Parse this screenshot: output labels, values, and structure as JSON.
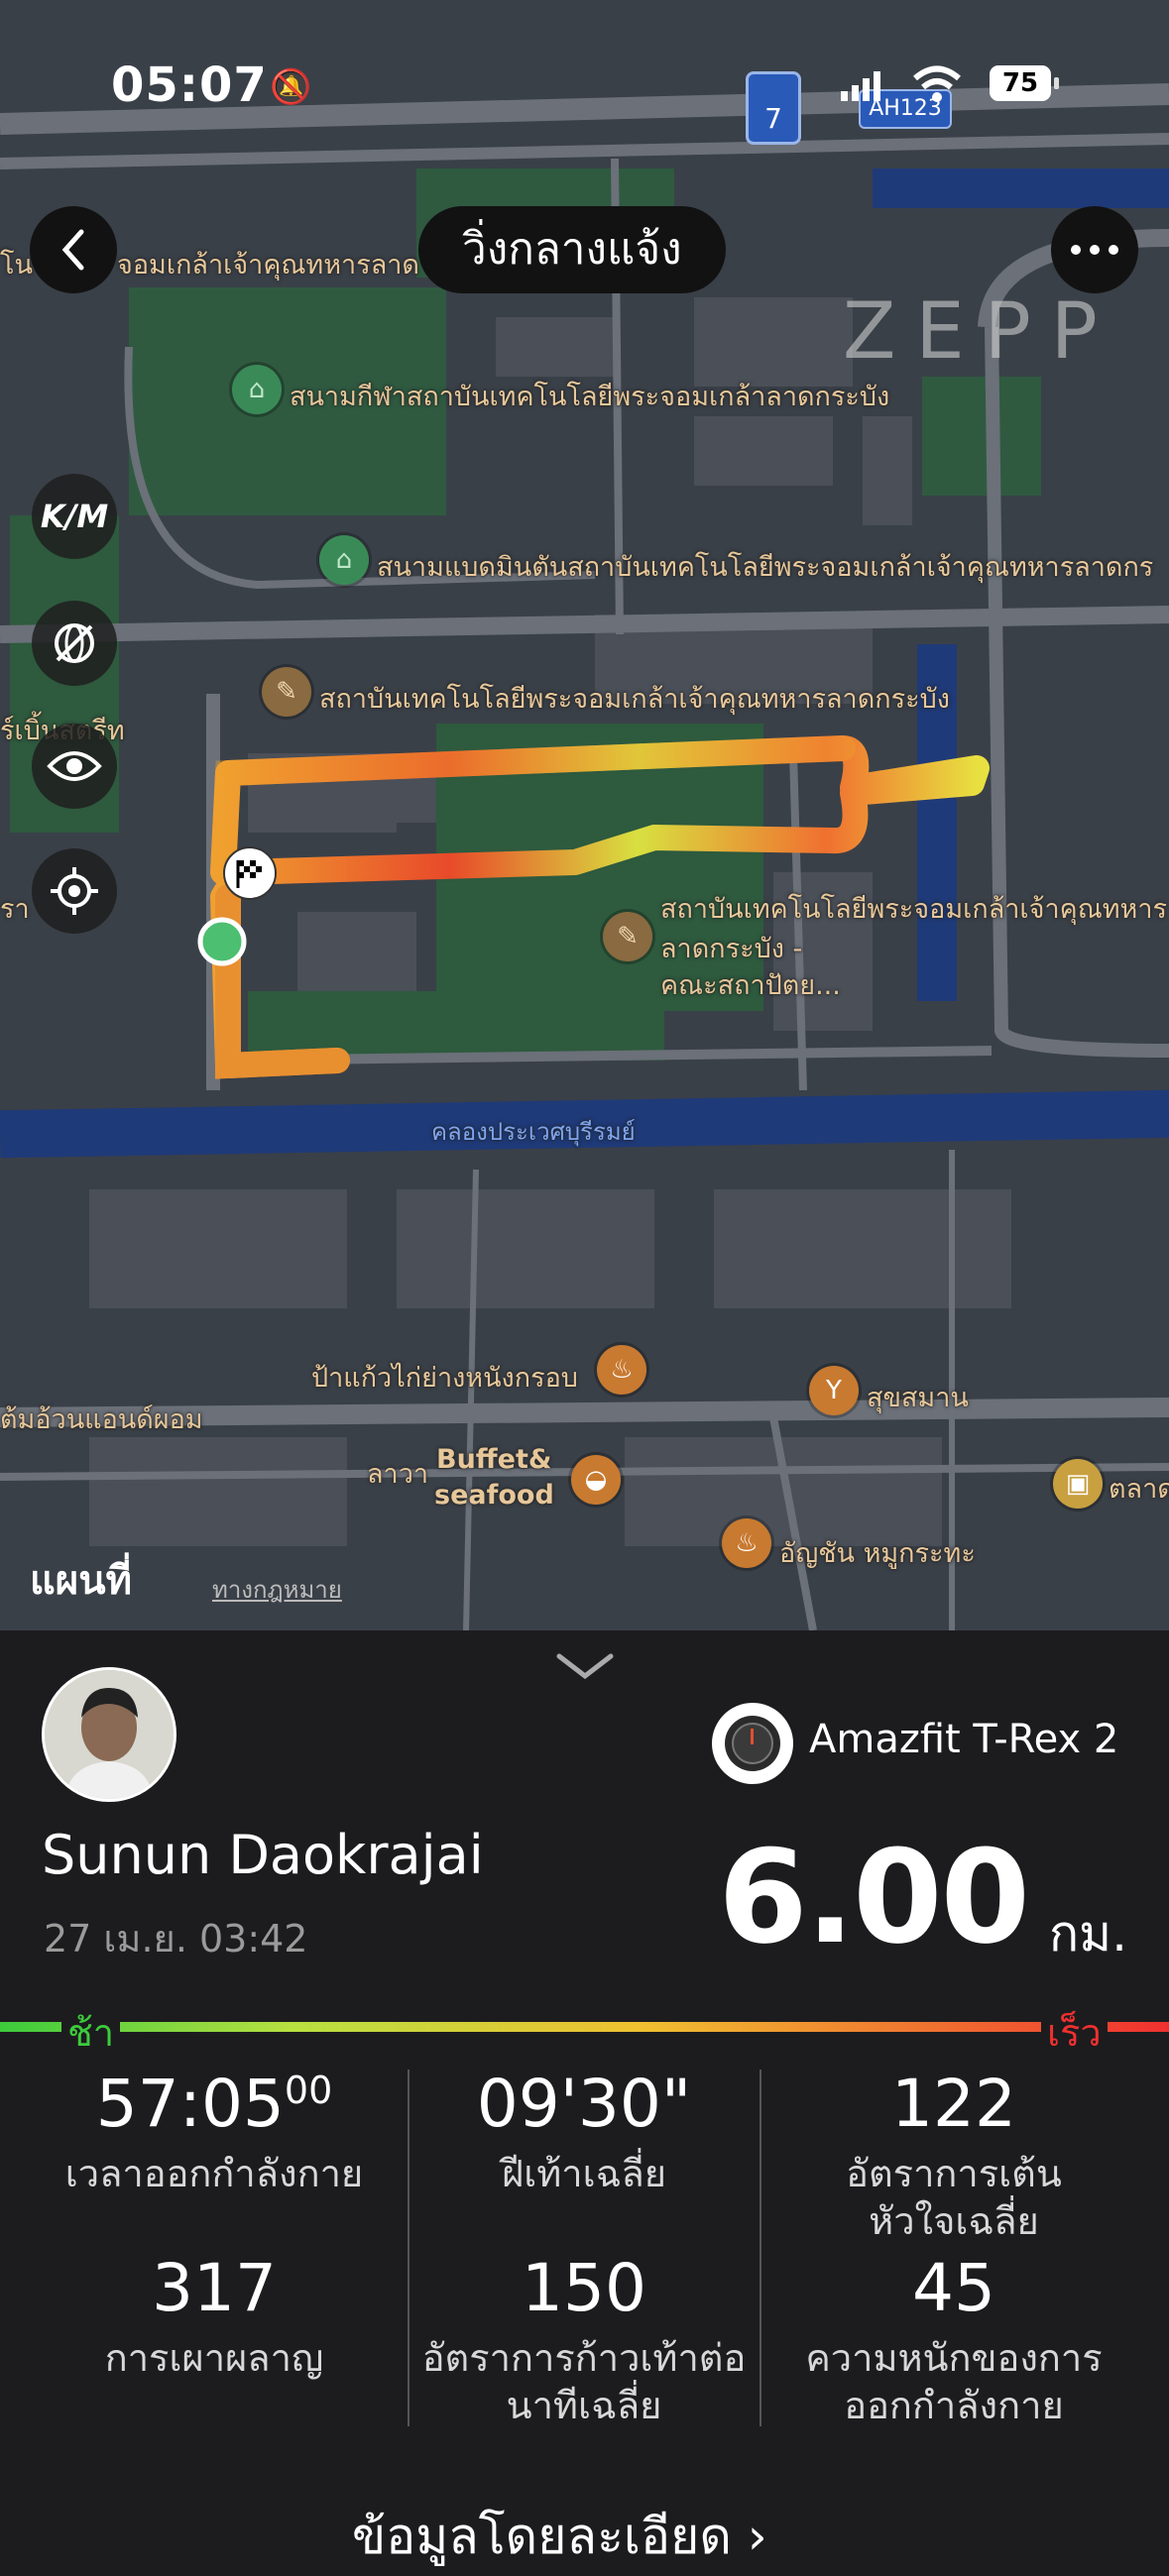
{
  "status_bar": {
    "time": "05:07",
    "battery": "75"
  },
  "header": {
    "title": "วิ่งกลางแจ้ง"
  },
  "brand": "ZEPP",
  "map": {
    "road_badge": "7",
    "highway_label": "AH123",
    "pois": [
      "สนามกีฬาสถาบันเทคโนโลยีพระจอมเกล้าลาดกระบัง",
      "สนามแบดมินตันสถาบันเทคโนโลยีพระจอมเกล้าเจ้าคุณทหารลาดกร",
      "สถาบันเทคโนโลยีพระจอมเกล้าเจ้าคุณทหารลาดกระบัง",
      "สถาบันเทคโนโลยีพระจอมเกล้าเจ้าคุณทหาร",
      "ลาดกระบัง -",
      "คณะสถาปัตย...",
      "คลองประเวศบุรีรมย์",
      "ป้าแก้วไก่ย่างหนังกรอบ",
      "สุขสมาน",
      "ต้มอ้วนแอนด์ผอม",
      "ลาวา",
      "Buffet&",
      "seafood",
      "อัญชัน หมูกระทะ",
      "ตลาด",
      "จอมเกล้าเจ้าคุณทหารลาด",
      "ร์เบิ้นสตรีท"
    ],
    "attribution": "แผนที่",
    "legal": "ทางกฎหมาย"
  },
  "workout": {
    "user_name": "Sunun Daokrajai",
    "date": "27 เม.ย. 03:42",
    "device": "Amazfit T-Rex 2",
    "distance": "6.00",
    "distance_unit": "กม.",
    "pace_slow": "ช้า",
    "pace_fast": "เร็ว"
  },
  "stats": [
    {
      "value": "57:05",
      "value_sup": "00",
      "label": "เวลาออกกำลังกาย"
    },
    {
      "value": "09'30\"",
      "label": "ฝีเท้าเฉลี่ย"
    },
    {
      "value": "122",
      "label": "อัตราการเต้น\nหัวใจเฉลี่ย"
    },
    {
      "value": "317",
      "label": "การเผาผลาญ"
    },
    {
      "value": "150",
      "label": "อัตราการก้าวเท้าต่อ\nนาทีเฉลี่ย"
    },
    {
      "value": "45",
      "label": "ความหนักของการ\nออกกำลังกาย"
    }
  ],
  "detail_link": "ข้อมูลโดยละเอียด",
  "colors": {
    "slow": "#3ccb3c",
    "fast": "#f03030",
    "map_bg": "#3b4049"
  }
}
